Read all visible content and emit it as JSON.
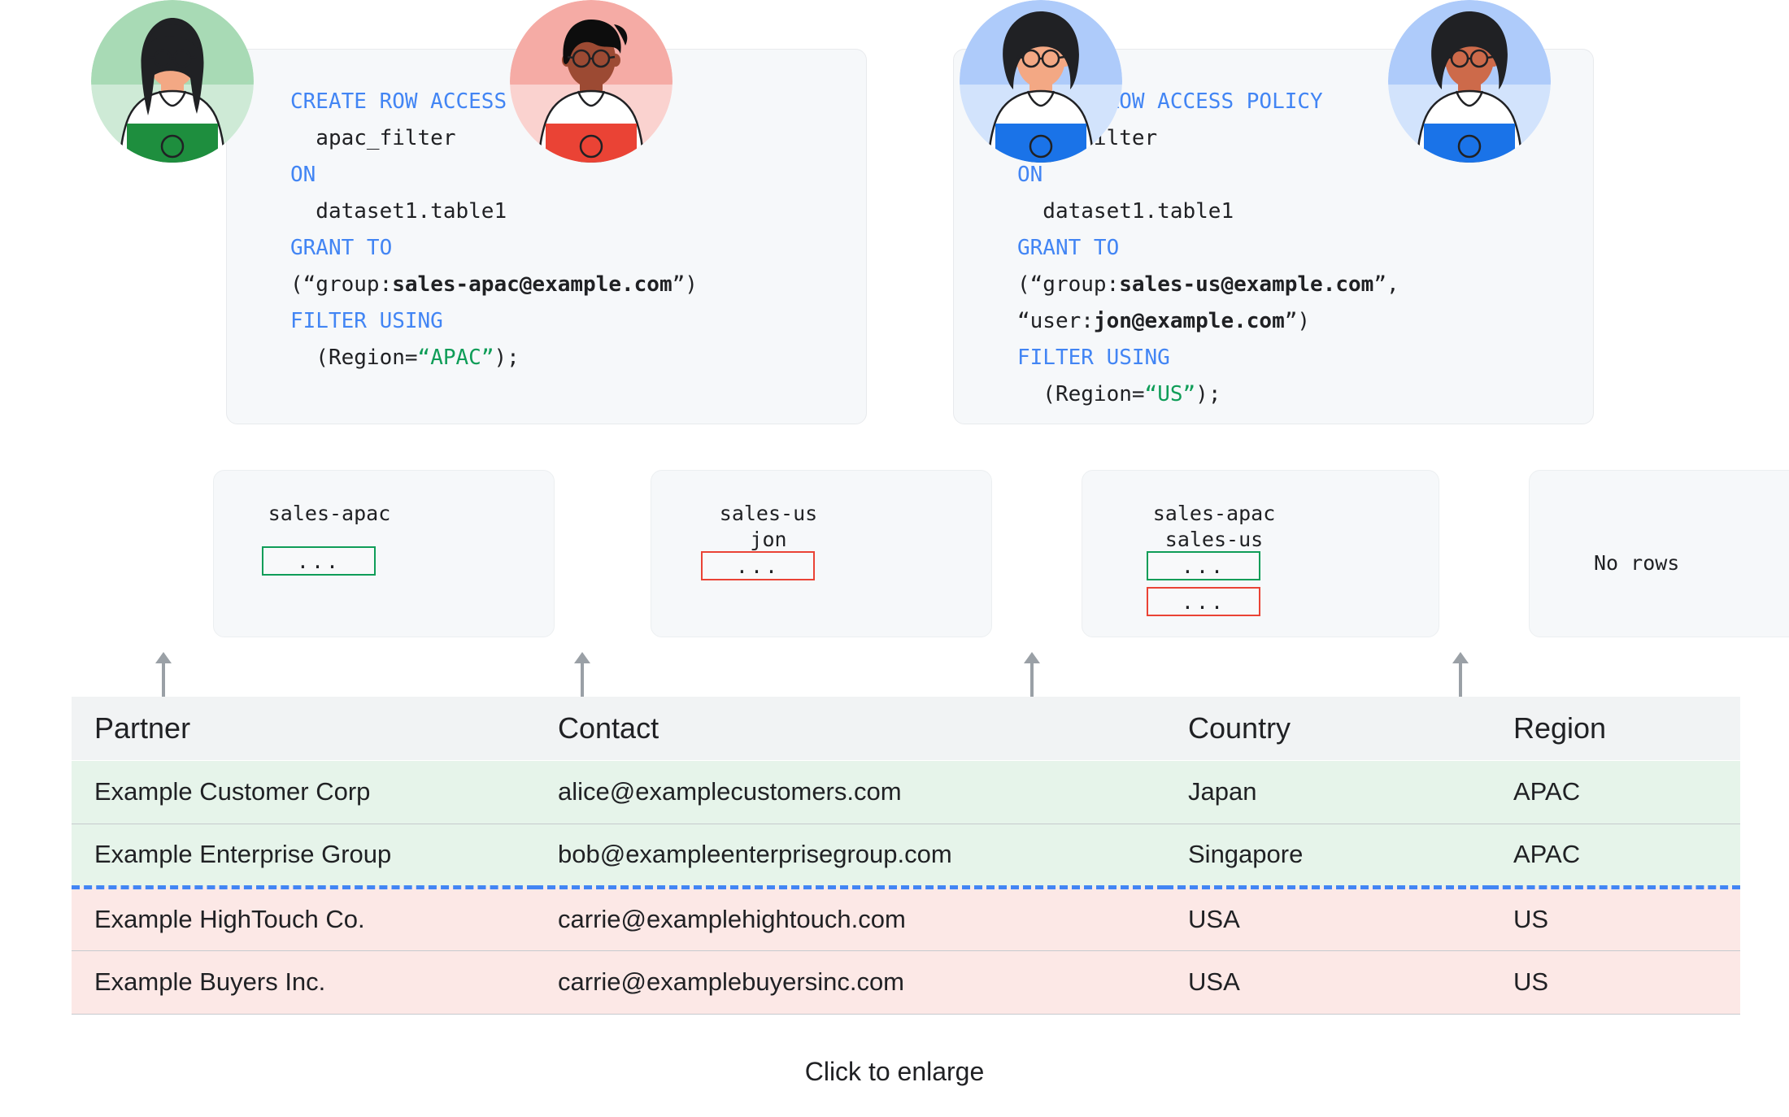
{
  "code_blocks": [
    {
      "id": "apac",
      "lines": [
        [
          {
            "t": "CREATE ROW ACCESS POLICY",
            "c": "kw"
          }
        ],
        [
          {
            "t": "  apac_filter",
            "c": "plain"
          }
        ],
        [
          {
            "t": "ON",
            "c": "kw"
          }
        ],
        [
          {
            "t": "  dataset1.table1",
            "c": "plain"
          }
        ],
        [
          {
            "t": "GRANT TO",
            "c": "kw"
          }
        ],
        [
          {
            "t": "(“group:",
            "c": "plain"
          },
          {
            "t": "sales-apac@example.com",
            "c": "b"
          },
          {
            "t": "”)",
            "c": "plain"
          }
        ],
        [
          {
            "t": "FILTER USING",
            "c": "kw"
          }
        ],
        [
          {
            "t": "  (Region=",
            "c": "plain"
          },
          {
            "t": "“APAC”",
            "c": "str"
          },
          {
            "t": ");",
            "c": "plain"
          }
        ]
      ]
    },
    {
      "id": "us",
      "lines": [
        [
          {
            "t": "CREATE ROW ACCESS POLICY",
            "c": "kw"
          }
        ],
        [
          {
            "t": "  us_filter",
            "c": "plain"
          }
        ],
        [
          {
            "t": "ON",
            "c": "kw"
          }
        ],
        [
          {
            "t": "  dataset1.table1",
            "c": "plain"
          }
        ],
        [
          {
            "t": "GRANT TO",
            "c": "kw"
          }
        ],
        [
          {
            "t": "(“group:",
            "c": "plain"
          },
          {
            "t": "sales-us@example.com",
            "c": "b"
          },
          {
            "t": "”,",
            "c": "plain"
          }
        ],
        [
          {
            "t": "“user:",
            "c": "plain"
          },
          {
            "t": "jon@example.com",
            "c": "b"
          },
          {
            "t": "”)",
            "c": "plain"
          }
        ],
        [
          {
            "t": "FILTER USING",
            "c": "kw"
          }
        ],
        [
          {
            "t": "  (Region=",
            "c": "plain"
          },
          {
            "t": "“US”",
            "c": "str"
          },
          {
            "t": ");",
            "c": "plain"
          }
        ]
      ]
    }
  ],
  "personas": [
    {
      "id": "persona-1",
      "labels": "sales-apac",
      "boxes": [
        {
          "text": "...",
          "color": "green"
        }
      ],
      "no_rows_text": "",
      "avatar": {
        "bg_top": "#a8dab5",
        "bg_bottom": "#ceead6",
        "skin": "#f3a884",
        "hair": "#202124",
        "shirt": "#1e8e3e",
        "hair_style": "long"
      }
    },
    {
      "id": "persona-2",
      "labels": "sales-us\njon",
      "boxes": [
        {
          "text": "...",
          "color": "red"
        }
      ],
      "no_rows_text": "",
      "avatar": {
        "bg_top": "#f5aba5",
        "bg_bottom": "#fad2cf",
        "skin": "#9c4a33",
        "hair": "#0d0d0d",
        "shirt": "#ea4335",
        "hair_style": "short"
      }
    },
    {
      "id": "persona-3",
      "labels": "sales-apac\nsales-us",
      "boxes": [
        {
          "text": "...",
          "color": "green"
        },
        {
          "text": "...",
          "color": "red"
        }
      ],
      "no_rows_text": "",
      "avatar": {
        "bg_top": "#aecbfa",
        "bg_bottom": "#d2e3fc",
        "skin": "#f3a884",
        "hair": "#202124",
        "shirt": "#1a73e8",
        "hair_style": "afro"
      }
    },
    {
      "id": "persona-4",
      "labels": "",
      "boxes": [],
      "no_rows_text": "No rows",
      "avatar": {
        "bg_top": "#aecbfa",
        "bg_bottom": "#d2e3fc",
        "skin": "#cd6a4a",
        "hair": "#202124",
        "shirt": "#1a73e8",
        "hair_style": "afro"
      }
    }
  ],
  "table": {
    "headers": [
      "Partner",
      "Contact",
      "Country",
      "Region"
    ],
    "rows": [
      {
        "partner": "Example Customer Corp",
        "contact": "alice@examplecustomers.com",
        "country": "Japan",
        "region": "APAC",
        "group": "apac"
      },
      {
        "partner": "Example Enterprise Group",
        "contact": "bob@exampleenterprisegroup.com",
        "country": "Singapore",
        "region": "APAC",
        "group": "apac"
      },
      {
        "partner": "Example HighTouch Co.",
        "contact": "carrie@examplehightouch.com",
        "country": "USA",
        "region": "US",
        "group": "us"
      },
      {
        "partner": "Example Buyers Inc.",
        "contact": "carrie@examplebuyersinc.com",
        "country": "USA",
        "region": "US",
        "group": "us"
      }
    ],
    "divider_after_row": 2,
    "divider_color": "#4285f4"
  },
  "caption": "Click to enlarge",
  "colors": {
    "keyword_blue": "#4285f4",
    "string_green": "#0f9d58",
    "region_apac": "#0f9d58",
    "region_us": "#ea4335",
    "card_bg": "#f6f8fa",
    "header_bg": "#f1f3f4",
    "row_apac_bg": "#e6f4ea",
    "row_us_bg": "#fce8e6",
    "arrow_gray": "#9aa0a6"
  }
}
